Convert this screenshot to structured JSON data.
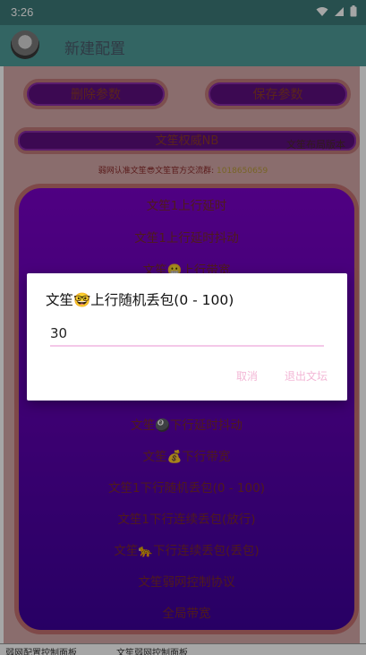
{
  "status_bar": {
    "time": "3:26",
    "icons": [
      "wifi-icon",
      "signal-icon",
      "battery-icon"
    ]
  },
  "app_bar": {
    "title": "新建配置"
  },
  "buttons": {
    "delete_label": "删除参数",
    "save_label": "保存参数"
  },
  "banner": {
    "center_label": "文笙权威NB",
    "right_label": "文笙布局版本"
  },
  "notice": {
    "text": "弱网认准文笙😎文笙官方交流群: ",
    "group": "1018650659"
  },
  "menu_items": [
    "文笙1上行延时",
    "文笙1上行延时抖动",
    "文笙😬上行带宽",
    "文笙🎱下行延时抖动",
    "文笙💰下行带宽",
    "文笙1下行随机丢包(0 - 100)",
    "文笙1下行连续丢包(放行)",
    "文笙🐆下行连续丢包(丢包)",
    "文笙弱网控制协议",
    "全局带宽"
  ],
  "dialog": {
    "title": "文笙🤓上行随机丢包(0 - 100)",
    "input_value": "30",
    "cancel_label": "取消",
    "exit_label": "退出文坛"
  },
  "bottom_strip": {
    "left_text": "弱网配置控制面板",
    "right_text": "文笙弱网控制面板"
  },
  "colors": {
    "status_bar": "#3d7a78",
    "app_bar": "#4f9b98",
    "panel_top": "#7a00c8",
    "panel_bottom": "#3d009a",
    "accent_pink": "#f3b7d6"
  }
}
